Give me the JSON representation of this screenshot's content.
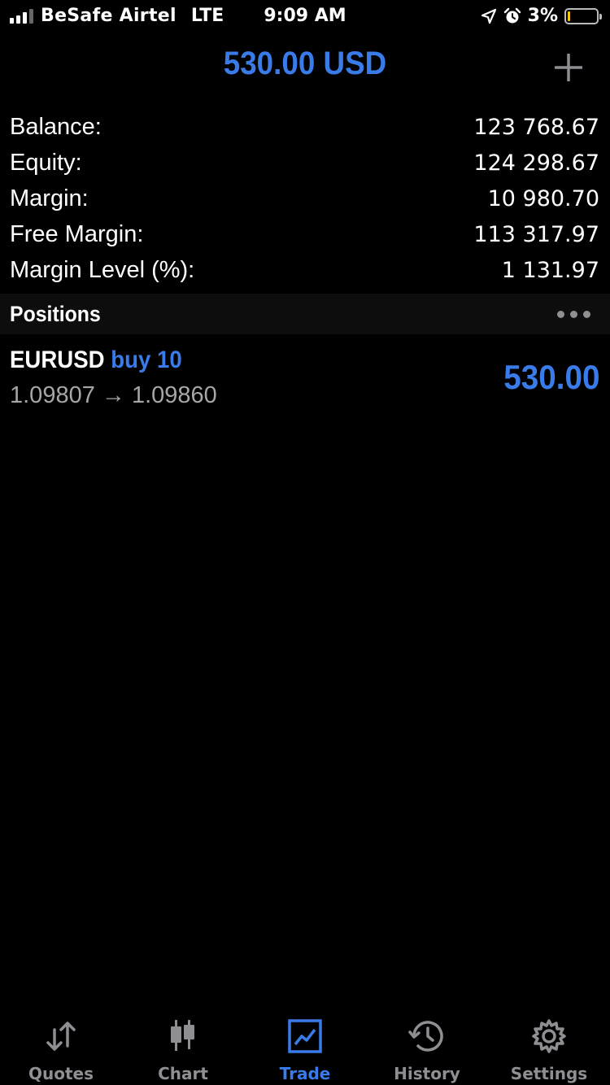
{
  "status_bar": {
    "carrier": "BeSafe Airtel",
    "network": "LTE",
    "time": "9:09 AM",
    "battery_percent": "3%",
    "battery_level": 0.03,
    "battery_color": "#f5c518"
  },
  "header": {
    "title": "530.00 USD",
    "add_icon": "plus-icon"
  },
  "account": {
    "rows": [
      {
        "label": "Balance:",
        "value": "123 768.67"
      },
      {
        "label": "Equity:",
        "value": "124 298.67"
      },
      {
        "label": "Margin:",
        "value": "10 980.70"
      },
      {
        "label": "Free Margin:",
        "value": "113 317.97"
      },
      {
        "label": "Margin Level (%):",
        "value": "1 131.97"
      }
    ]
  },
  "positions": {
    "title": "Positions",
    "items": [
      {
        "symbol": "EURUSD",
        "type": "buy 10",
        "prices": "1.09807 → 1.09860",
        "profit": "530.00"
      }
    ]
  },
  "tabs": [
    {
      "label": "Quotes",
      "icon": "quotes-arrows-icon",
      "active": false
    },
    {
      "label": "Chart",
      "icon": "candlestick-icon",
      "active": false
    },
    {
      "label": "Trade",
      "icon": "trade-chart-icon",
      "active": true
    },
    {
      "label": "History",
      "icon": "history-clock-icon",
      "active": false
    },
    {
      "label": "Settings",
      "icon": "gear-icon",
      "active": false
    }
  ],
  "colors": {
    "accent": "#3a7bea",
    "background": "#000000",
    "secondary_text": "#a6a6a6",
    "inactive_tab": "#8e8e93"
  }
}
